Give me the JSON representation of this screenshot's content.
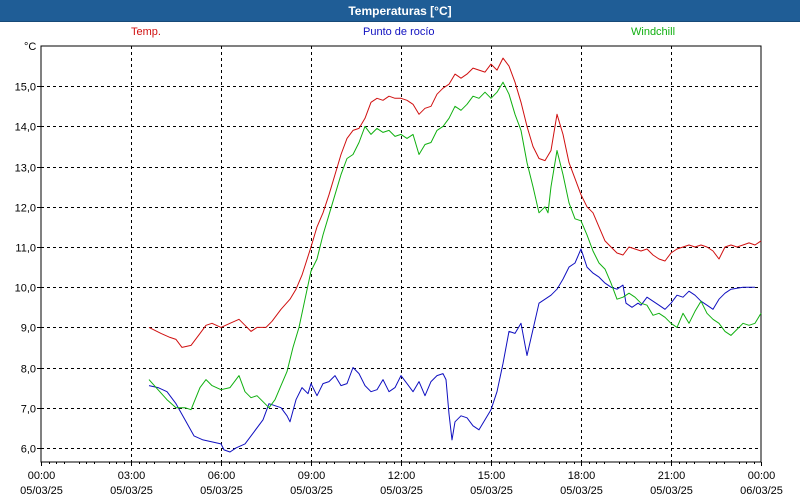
{
  "window": {
    "title": "Temperaturas [°C]"
  },
  "chart_data": {
    "type": "line",
    "title": "Temperaturas [°C]",
    "ylabel": "°C",
    "xlabel": "",
    "ylim": [
      5.65,
      16.0
    ],
    "yticks": [
      6.0,
      7.0,
      8.0,
      9.0,
      10.0,
      11.0,
      12.0,
      13.0,
      14.0,
      15.0
    ],
    "yticklabels": [
      "6,0",
      "7,0",
      "8,0",
      "9,0",
      "10,0",
      "11,0",
      "12,0",
      "13,0",
      "14,0",
      "15,0"
    ],
    "xlim": [
      0,
      24
    ],
    "xticks": [
      {
        "h": 0,
        "time": "00:00",
        "date": "05/03/25"
      },
      {
        "h": 3,
        "time": "03:00",
        "date": "05/03/25"
      },
      {
        "h": 6,
        "time": "06:00",
        "date": "05/03/25"
      },
      {
        "h": 9,
        "time": "09:00",
        "date": "05/03/25"
      },
      {
        "h": 12,
        "time": "12:00",
        "date": "05/03/25"
      },
      {
        "h": 15,
        "time": "15:00",
        "date": "05/03/25"
      },
      {
        "h": 18,
        "time": "18:00",
        "date": "05/03/25"
      },
      {
        "h": 21,
        "time": "21:00",
        "date": "05/03/25"
      },
      {
        "h": 24,
        "time": "00:00",
        "date": "06/03/25"
      }
    ],
    "grid": true,
    "legend": "top",
    "series": [
      {
        "name": "Temp.",
        "color": "#d01010",
        "points": [
          [
            3.6,
            9.0
          ],
          [
            4.0,
            8.85
          ],
          [
            4.3,
            8.75
          ],
          [
            4.5,
            8.7
          ],
          [
            4.7,
            8.5
          ],
          [
            5.0,
            8.55
          ],
          [
            5.3,
            8.85
          ],
          [
            5.5,
            9.05
          ],
          [
            5.7,
            9.1
          ],
          [
            6.0,
            9.0
          ],
          [
            6.3,
            9.1
          ],
          [
            6.6,
            9.2
          ],
          [
            6.8,
            9.05
          ],
          [
            7.0,
            8.9
          ],
          [
            7.2,
            9.0
          ],
          [
            7.5,
            9.0
          ],
          [
            7.7,
            9.15
          ],
          [
            8.0,
            9.45
          ],
          [
            8.3,
            9.7
          ],
          [
            8.5,
            9.95
          ],
          [
            8.7,
            10.3
          ],
          [
            9.0,
            11.0
          ],
          [
            9.2,
            11.5
          ],
          [
            9.4,
            11.85
          ],
          [
            9.6,
            12.3
          ],
          [
            9.8,
            12.8
          ],
          [
            10.0,
            13.3
          ],
          [
            10.2,
            13.7
          ],
          [
            10.4,
            13.9
          ],
          [
            10.6,
            13.95
          ],
          [
            10.8,
            14.2
          ],
          [
            11.0,
            14.6
          ],
          [
            11.2,
            14.7
          ],
          [
            11.4,
            14.65
          ],
          [
            11.6,
            14.75
          ],
          [
            11.8,
            14.7
          ],
          [
            12.0,
            14.7
          ],
          [
            12.2,
            14.65
          ],
          [
            12.4,
            14.55
          ],
          [
            12.6,
            14.3
          ],
          [
            12.8,
            14.45
          ],
          [
            13.0,
            14.5
          ],
          [
            13.2,
            14.8
          ],
          [
            13.4,
            14.95
          ],
          [
            13.6,
            15.05
          ],
          [
            13.8,
            15.3
          ],
          [
            14.0,
            15.2
          ],
          [
            14.2,
            15.3
          ],
          [
            14.4,
            15.45
          ],
          [
            14.6,
            15.4
          ],
          [
            14.8,
            15.35
          ],
          [
            15.0,
            15.55
          ],
          [
            15.2,
            15.4
          ],
          [
            15.4,
            15.7
          ],
          [
            15.6,
            15.5
          ],
          [
            15.8,
            15.1
          ],
          [
            16.0,
            14.6
          ],
          [
            16.2,
            14.0
          ],
          [
            16.4,
            13.5
          ],
          [
            16.6,
            13.2
          ],
          [
            16.8,
            13.15
          ],
          [
            17.0,
            13.4
          ],
          [
            17.2,
            14.3
          ],
          [
            17.4,
            13.8
          ],
          [
            17.6,
            13.1
          ],
          [
            17.8,
            12.7
          ],
          [
            18.0,
            12.3
          ],
          [
            18.2,
            12.0
          ],
          [
            18.4,
            11.85
          ],
          [
            18.6,
            11.5
          ],
          [
            18.8,
            11.15
          ],
          [
            19.0,
            11.0
          ],
          [
            19.2,
            10.85
          ],
          [
            19.4,
            10.8
          ],
          [
            19.6,
            11.0
          ],
          [
            19.8,
            10.95
          ],
          [
            20.0,
            10.9
          ],
          [
            20.2,
            10.95
          ],
          [
            20.4,
            10.8
          ],
          [
            20.6,
            10.7
          ],
          [
            20.8,
            10.65
          ],
          [
            21.0,
            10.85
          ],
          [
            21.2,
            10.95
          ],
          [
            21.4,
            11.0
          ],
          [
            21.6,
            11.05
          ],
          [
            21.8,
            11.0
          ],
          [
            22.0,
            11.05
          ],
          [
            22.2,
            11.0
          ],
          [
            22.4,
            10.9
          ],
          [
            22.6,
            10.7
          ],
          [
            22.8,
            11.0
          ],
          [
            23.0,
            11.05
          ],
          [
            23.2,
            11.0
          ],
          [
            23.4,
            11.05
          ],
          [
            23.6,
            11.1
          ],
          [
            23.8,
            11.05
          ],
          [
            24.0,
            11.15
          ]
        ]
      },
      {
        "name": "Punto de rocío",
        "color": "#1010c0",
        "points": [
          [
            3.6,
            7.55
          ],
          [
            3.9,
            7.5
          ],
          [
            4.2,
            7.4
          ],
          [
            4.5,
            7.1
          ],
          [
            4.8,
            6.7
          ],
          [
            5.1,
            6.3
          ],
          [
            5.4,
            6.2
          ],
          [
            5.7,
            6.15
          ],
          [
            6.0,
            6.1
          ],
          [
            6.1,
            5.95
          ],
          [
            6.3,
            5.9
          ],
          [
            6.5,
            6.0
          ],
          [
            6.8,
            6.1
          ],
          [
            7.1,
            6.4
          ],
          [
            7.4,
            6.7
          ],
          [
            7.6,
            7.1
          ],
          [
            7.8,
            7.05
          ],
          [
            8.0,
            7.0
          ],
          [
            8.2,
            6.8
          ],
          [
            8.3,
            6.65
          ],
          [
            8.5,
            7.2
          ],
          [
            8.7,
            7.5
          ],
          [
            8.9,
            7.35
          ],
          [
            9.0,
            7.6
          ],
          [
            9.2,
            7.3
          ],
          [
            9.4,
            7.6
          ],
          [
            9.6,
            7.65
          ],
          [
            9.8,
            7.8
          ],
          [
            10.0,
            7.55
          ],
          [
            10.2,
            7.6
          ],
          [
            10.4,
            8.0
          ],
          [
            10.6,
            7.85
          ],
          [
            10.8,
            7.55
          ],
          [
            11.0,
            7.4
          ],
          [
            11.2,
            7.45
          ],
          [
            11.4,
            7.7
          ],
          [
            11.6,
            7.4
          ],
          [
            11.8,
            7.5
          ],
          [
            12.0,
            7.8
          ],
          [
            12.2,
            7.6
          ],
          [
            12.4,
            7.4
          ],
          [
            12.6,
            7.65
          ],
          [
            12.8,
            7.3
          ],
          [
            13.0,
            7.65
          ],
          [
            13.2,
            7.8
          ],
          [
            13.4,
            7.85
          ],
          [
            13.5,
            7.7
          ],
          [
            13.6,
            6.85
          ],
          [
            13.7,
            6.2
          ],
          [
            13.8,
            6.65
          ],
          [
            14.0,
            6.8
          ],
          [
            14.2,
            6.75
          ],
          [
            14.4,
            6.55
          ],
          [
            14.6,
            6.45
          ],
          [
            14.8,
            6.7
          ],
          [
            15.0,
            6.95
          ],
          [
            15.2,
            7.4
          ],
          [
            15.4,
            8.1
          ],
          [
            15.6,
            8.9
          ],
          [
            15.8,
            8.85
          ],
          [
            16.0,
            9.1
          ],
          [
            16.2,
            8.3
          ],
          [
            16.4,
            8.95
          ],
          [
            16.6,
            9.6
          ],
          [
            16.8,
            9.7
          ],
          [
            17.0,
            9.8
          ],
          [
            17.2,
            9.95
          ],
          [
            17.4,
            10.2
          ],
          [
            17.6,
            10.5
          ],
          [
            17.8,
            10.6
          ],
          [
            18.0,
            10.95
          ],
          [
            18.2,
            10.5
          ],
          [
            18.4,
            10.35
          ],
          [
            18.6,
            10.25
          ],
          [
            18.8,
            10.1
          ],
          [
            19.0,
            10.0
          ],
          [
            19.2,
            9.95
          ],
          [
            19.4,
            10.05
          ],
          [
            19.5,
            9.6
          ],
          [
            19.7,
            9.5
          ],
          [
            19.9,
            9.6
          ],
          [
            20.0,
            9.55
          ],
          [
            20.2,
            9.75
          ],
          [
            20.4,
            9.65
          ],
          [
            20.6,
            9.55
          ],
          [
            20.8,
            9.45
          ],
          [
            21.0,
            9.6
          ],
          [
            21.2,
            9.8
          ],
          [
            21.4,
            9.75
          ],
          [
            21.6,
            9.9
          ],
          [
            21.8,
            9.8
          ],
          [
            22.0,
            9.65
          ],
          [
            22.2,
            9.55
          ],
          [
            22.4,
            9.45
          ],
          [
            22.6,
            9.7
          ],
          [
            22.8,
            9.85
          ],
          [
            23.0,
            9.95
          ],
          [
            23.4,
            10.0
          ],
          [
            23.8,
            10.0
          ]
        ]
      },
      {
        "name": "Windchill",
        "color": "#10b010",
        "points": [
          [
            3.6,
            7.7
          ],
          [
            3.9,
            7.45
          ],
          [
            4.2,
            7.2
          ],
          [
            4.5,
            7.0
          ],
          [
            4.8,
            7.0
          ],
          [
            5.0,
            6.95
          ],
          [
            5.3,
            7.5
          ],
          [
            5.5,
            7.7
          ],
          [
            5.7,
            7.55
          ],
          [
            6.0,
            7.45
          ],
          [
            6.3,
            7.5
          ],
          [
            6.6,
            7.8
          ],
          [
            6.8,
            7.4
          ],
          [
            7.0,
            7.25
          ],
          [
            7.2,
            7.3
          ],
          [
            7.4,
            7.15
          ],
          [
            7.6,
            7.0
          ],
          [
            7.8,
            7.2
          ],
          [
            8.0,
            7.55
          ],
          [
            8.2,
            7.9
          ],
          [
            8.4,
            8.5
          ],
          [
            8.6,
            9.0
          ],
          [
            8.8,
            9.7
          ],
          [
            9.0,
            10.4
          ],
          [
            9.2,
            10.7
          ],
          [
            9.4,
            11.3
          ],
          [
            9.6,
            11.8
          ],
          [
            9.8,
            12.3
          ],
          [
            10.0,
            12.8
          ],
          [
            10.2,
            13.2
          ],
          [
            10.4,
            13.3
          ],
          [
            10.6,
            13.6
          ],
          [
            10.8,
            14.0
          ],
          [
            11.0,
            13.8
          ],
          [
            11.2,
            13.95
          ],
          [
            11.4,
            13.85
          ],
          [
            11.6,
            13.9
          ],
          [
            11.8,
            13.75
          ],
          [
            12.0,
            13.8
          ],
          [
            12.2,
            13.7
          ],
          [
            12.4,
            13.8
          ],
          [
            12.6,
            13.3
          ],
          [
            12.8,
            13.55
          ],
          [
            13.0,
            13.6
          ],
          [
            13.2,
            13.9
          ],
          [
            13.4,
            14.0
          ],
          [
            13.6,
            14.2
          ],
          [
            13.8,
            14.5
          ],
          [
            14.0,
            14.4
          ],
          [
            14.2,
            14.55
          ],
          [
            14.4,
            14.75
          ],
          [
            14.6,
            14.7
          ],
          [
            14.8,
            14.85
          ],
          [
            15.0,
            14.7
          ],
          [
            15.2,
            14.85
          ],
          [
            15.4,
            15.1
          ],
          [
            15.6,
            14.8
          ],
          [
            15.8,
            14.3
          ],
          [
            16.0,
            13.9
          ],
          [
            16.2,
            13.1
          ],
          [
            16.4,
            12.5
          ],
          [
            16.6,
            11.85
          ],
          [
            16.8,
            12.0
          ],
          [
            16.9,
            11.85
          ],
          [
            17.0,
            12.5
          ],
          [
            17.2,
            13.4
          ],
          [
            17.4,
            12.8
          ],
          [
            17.6,
            12.1
          ],
          [
            17.8,
            11.7
          ],
          [
            18.0,
            11.65
          ],
          [
            18.2,
            11.3
          ],
          [
            18.4,
            10.9
          ],
          [
            18.6,
            10.6
          ],
          [
            18.8,
            10.45
          ],
          [
            19.0,
            10.1
          ],
          [
            19.2,
            9.7
          ],
          [
            19.4,
            9.75
          ],
          [
            19.6,
            9.85
          ],
          [
            19.8,
            9.75
          ],
          [
            20.0,
            9.6
          ],
          [
            20.2,
            9.55
          ],
          [
            20.4,
            9.3
          ],
          [
            20.6,
            9.35
          ],
          [
            20.8,
            9.25
          ],
          [
            21.0,
            9.1
          ],
          [
            21.2,
            9.0
          ],
          [
            21.4,
            9.35
          ],
          [
            21.6,
            9.1
          ],
          [
            21.8,
            9.4
          ],
          [
            22.0,
            9.65
          ],
          [
            22.2,
            9.35
          ],
          [
            22.4,
            9.2
          ],
          [
            22.6,
            9.1
          ],
          [
            22.8,
            8.9
          ],
          [
            23.0,
            8.8
          ],
          [
            23.2,
            8.95
          ],
          [
            23.4,
            9.1
          ],
          [
            23.6,
            9.05
          ],
          [
            23.8,
            9.1
          ],
          [
            24.0,
            9.35
          ]
        ]
      }
    ]
  }
}
